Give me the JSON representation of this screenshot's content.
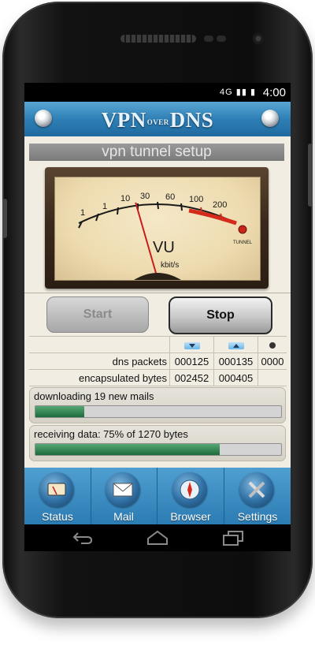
{
  "status_bar": {
    "network": "4G",
    "time": "4:00"
  },
  "app_title": {
    "part1": "VPN",
    "over": "OVER",
    "part2": "DNS"
  },
  "setup_header": "vpn tunnel setup",
  "meter": {
    "scale": [
      "1",
      "1",
      "10",
      "30",
      "60",
      "100",
      "200"
    ],
    "vu_label": "VU",
    "unit_label": "kbit/s",
    "tunnel_label": "TUNNEL",
    "level_fraction": 0.36
  },
  "buttons": {
    "start": "Start",
    "stop": "Stop"
  },
  "stats": {
    "rows": [
      {
        "label": "dns packets",
        "values": [
          "000125",
          "000135",
          "0000"
        ]
      },
      {
        "label": "encapsulated bytes",
        "values": [
          "002452",
          "000405",
          ""
        ]
      }
    ]
  },
  "progress": [
    {
      "text": "downloading 19 new mails",
      "fraction": 0.2
    },
    {
      "text": "receiving data: 75% of 1270 bytes",
      "fraction": 0.75
    }
  ],
  "tabs": [
    {
      "label": "Status",
      "icon": "meter-icon"
    },
    {
      "label": "Mail",
      "icon": "mail-icon"
    },
    {
      "label": "Browser",
      "icon": "compass-icon"
    },
    {
      "label": "Settings",
      "icon": "tools-icon"
    }
  ],
  "colors": {
    "accent_blue": "#2e7fb6",
    "progress_green": "#1f6b3c",
    "screen_bg": "#f1ede2"
  }
}
